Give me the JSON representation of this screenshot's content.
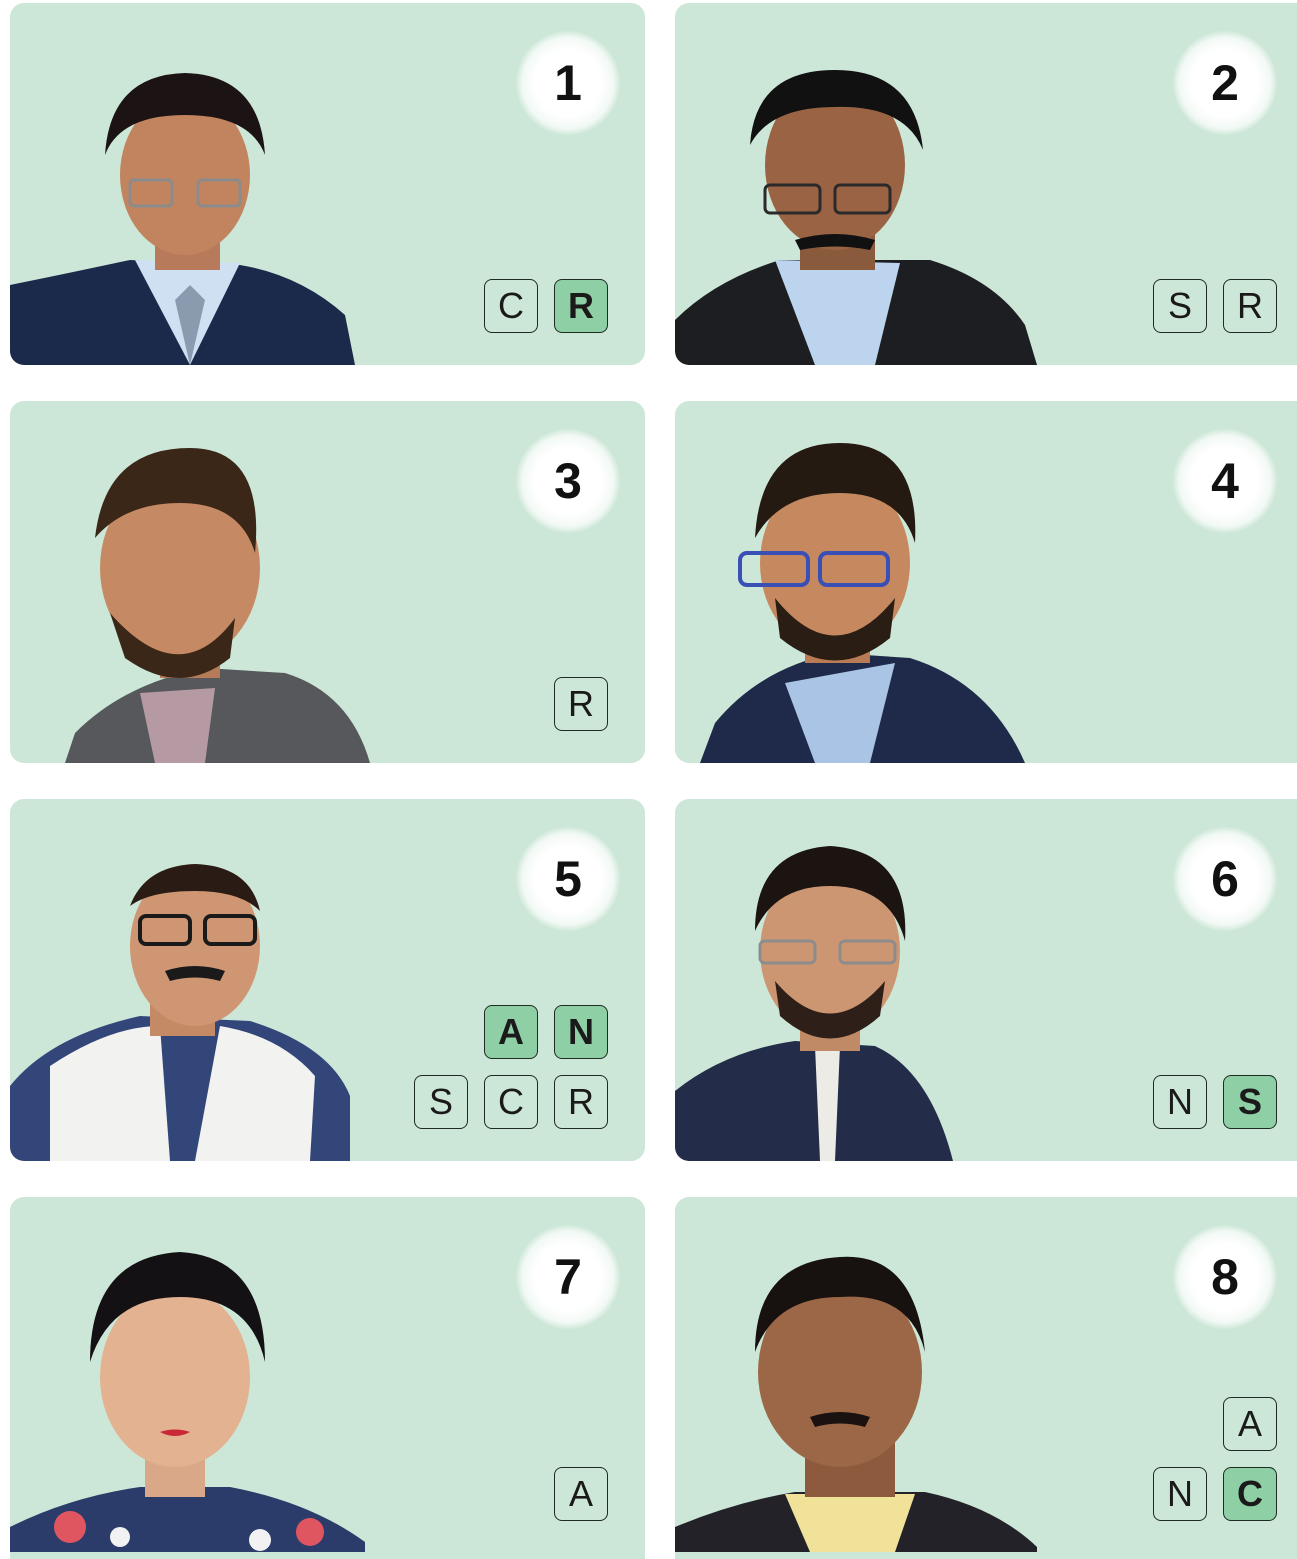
{
  "colors": {
    "card_bg": "#cce7d7",
    "badge_active_bg": "#8fcfa5",
    "badge_border": "#1e2a24",
    "page_bg": "#ffffff"
  },
  "cards": [
    {
      "number": "1",
      "photo": "man-in-dark-suit-striped-tie-portrait",
      "badge_rows": [
        [
          {
            "letter": "C",
            "active": false
          },
          {
            "letter": "R",
            "active": true
          }
        ]
      ]
    },
    {
      "number": "2",
      "photo": "man-with-mustache-dark-suit-portrait",
      "badge_rows": [
        [
          {
            "letter": "S",
            "active": false
          },
          {
            "letter": "R",
            "active": false
          }
        ]
      ]
    },
    {
      "number": "3",
      "photo": "bearded-man-grey-blazer-portrait",
      "badge_rows": [
        [
          {
            "letter": "R",
            "active": false
          }
        ]
      ]
    },
    {
      "number": "4",
      "photo": "man-with-blue-glasses-navy-blazer-portrait",
      "badge_rows": []
    },
    {
      "number": "5",
      "photo": "man-in-white-vest-portrait",
      "badge_rows": [
        [
          {
            "letter": "A",
            "active": true
          },
          {
            "letter": "N",
            "active": true
          }
        ],
        [
          {
            "letter": "S",
            "active": false
          },
          {
            "letter": "C",
            "active": false
          },
          {
            "letter": "R",
            "active": false
          }
        ]
      ]
    },
    {
      "number": "6",
      "photo": "man-in-navy-nehru-jacket-portrait",
      "badge_rows": [
        [
          {
            "letter": "N",
            "active": false
          },
          {
            "letter": "S",
            "active": true
          }
        ]
      ]
    },
    {
      "number": "7",
      "photo": "woman-in-floral-top-portrait",
      "badge_rows": [
        [
          {
            "letter": "A",
            "active": false
          }
        ]
      ]
    },
    {
      "number": "8",
      "photo": "man-in-dark-jacket-yellow-shirt-portrait",
      "badge_rows": [
        [
          {
            "letter": "A",
            "active": false
          }
        ],
        [
          {
            "letter": "N",
            "active": false
          },
          {
            "letter": "C",
            "active": true
          }
        ]
      ]
    }
  ]
}
